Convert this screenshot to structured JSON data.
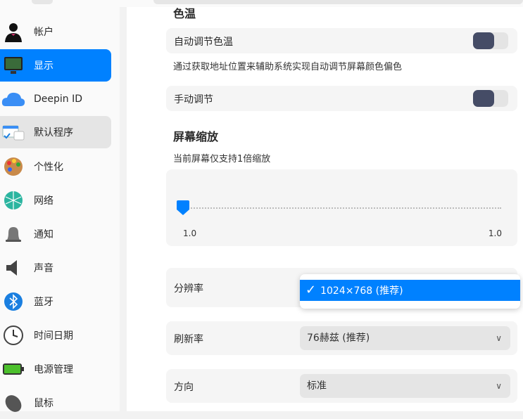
{
  "sidebar": {
    "items": [
      {
        "label": "帐户"
      },
      {
        "label": "显示"
      },
      {
        "label": "Deepin ID"
      },
      {
        "label": "默认程序"
      },
      {
        "label": "个性化"
      },
      {
        "label": "网络"
      },
      {
        "label": "通知"
      },
      {
        "label": "声音"
      },
      {
        "label": "蓝牙"
      },
      {
        "label": "时间日期"
      },
      {
        "label": "电源管理"
      },
      {
        "label": "鼠标"
      }
    ]
  },
  "color_temp": {
    "heading": "色温",
    "auto_label": "自动调节色温",
    "auto_on": false,
    "description": "通过获取地址位置来辅助系统实现自动调节屏幕颜色偏色",
    "manual_label": "手动调节",
    "manual_on": false
  },
  "scaling": {
    "heading": "屏幕缩放",
    "note": "当前屏幕仅支持1倍缩放",
    "min_label": "1.0",
    "max_label": "1.0",
    "value": 1.0
  },
  "resolution": {
    "label": "分辨率",
    "selected": "1024×768 (推荐)"
  },
  "refresh": {
    "label": "刷新率",
    "value": "76赫兹 (推荐)"
  },
  "orientation": {
    "label": "方向",
    "value": "标准"
  },
  "colors": {
    "accent": "#0081ff",
    "toggle_off": "#454c66"
  }
}
